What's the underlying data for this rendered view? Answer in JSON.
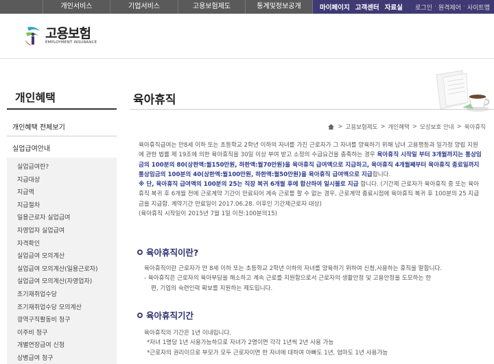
{
  "topnav": {
    "menu": [
      "개인서비스",
      "기업서비스",
      "고용보험제도",
      "통계및정보공개"
    ],
    "util": [
      "마이페이지",
      "고객센터",
      "자료실"
    ],
    "util2": [
      "로그인",
      "원격제어",
      "사이트맵"
    ]
  },
  "logo": {
    "ko": "고용보험",
    "en": "EMPLOYMENT INSURANCE"
  },
  "sidebar": {
    "title": "개인혜택",
    "item1": "개인혜택 전체보기",
    "item2": "실업급여안내",
    "sub": [
      "실업급여란?",
      "지급대상",
      "지급액",
      "지급절차",
      "일용근로자 실업급여",
      "자영업자 실업급여",
      "자격확인",
      "실업급여 모의계산",
      "실업급여 모의계산(일용근로자)",
      "실업급여 모의계산(자영업자)",
      "조기재취업수당",
      "조기재취업수당 모의계산",
      "광역구직활동비 청구",
      "이주비 청구",
      "개별연장급여 신청",
      "상병급여 청구"
    ]
  },
  "content": {
    "title": "육아휴직",
    "breadcrumb": [
      "고용보험제도",
      "개인혜택",
      "모성보호 안내",
      "육아휴직"
    ],
    "intro": {
      "p1a": "육아휴직급여는 만8세 이하 또는 초등학교 2학년 이하의 자녀를 가진 근로자가 그 자녀를 양육하기 위해 남녀 고용평등과 일가정 양립 지원에 관한 법률 제 19조에 의한 육아휴직을 30일 이상 부여 받고 소정의 수급요건을 충족하는 경우 ",
      "p1b": "육아휴직 시작일 부터 3개월까지는 통상임금의 100분의 80(상한액:월150만원, 하한액:월70만원)을 육아휴직 급여액으로 지급하고, 육아휴직 4개월째부터 육아휴직 종료일까지 통상임금의 100분의 40(상한액:월100만원, 하한액:월50만원)을 육아휴직 급여액으로 지급",
      "p1c": "합니다.",
      "p2a": "※ 단, 육아휴직 급여액의 100분의 25는 직장 복귀 6개월 후에 합산하여 일시불로 지급",
      "p2b": " 합니다. (기간제 근로자가 육아휴직 중 또는 육아휴직 복귀 후 6개월 전에 근로계약 기간이 만료되어 계속 근로를 할 수 없는 경우, 근로계약 종료시점에 육아휴직 복귀 후 100분의 25 지급금을 지급함. 계약기간 만료일이 2017.06.28. 이후인 기간제근로자 대상)",
      "p3": "(육아휴직 시작일이 2015년 7월 1일 이전:100분의15)"
    },
    "sec1": {
      "title": "육아휴직이란?",
      "l1": "육아휴직이란 근로자가 만 8세 이하 또는 초등학교 2학년 이하의 자녀를 양육하기 위하여 신청,사용하는 휴직을 말합니다.",
      "l2": "- 육아휴직은 근로자의 육아부담을 해소하고 계속 근로를 지원함으로서 근로자의 생활안정 및 고용안정을 도모하는 한",
      "l3": "편, 기업의 숙련인력 확보를 지원하는 제도입니다."
    },
    "sec2": {
      "title": "육아휴직기간",
      "l1": "육아휴직의 기간은 1년 이내입니다.",
      "l2": "*자녀 1명당 1년 사용가능하므로 자녀가 2명이면 각각 1년씩 2년 사용 가능",
      "l3": "*근로자의 권리이므로 부모가 모두 근로자이면 한 자녀에 대하여 아빠도 1년, 엄마도 1년 사용가능"
    }
  }
}
